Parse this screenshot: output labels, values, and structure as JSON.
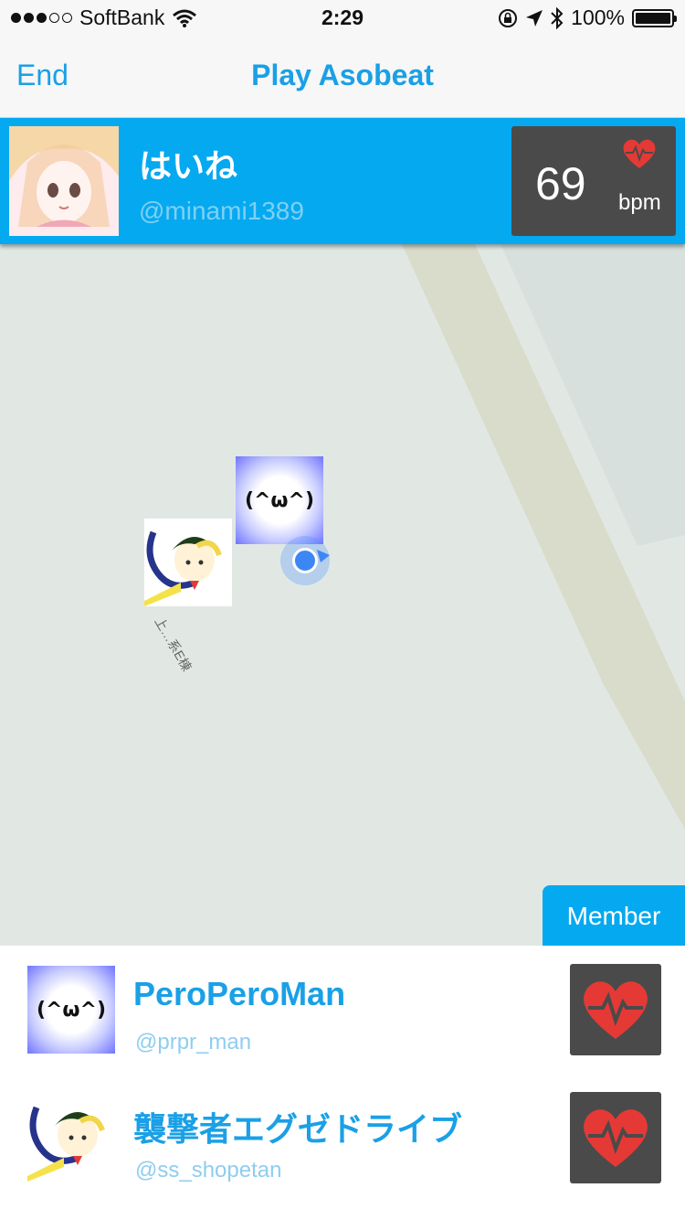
{
  "status_bar": {
    "carrier": "SoftBank",
    "time": "2:29",
    "battery": "100%"
  },
  "nav": {
    "end_label": "End",
    "title": "Play Asobeat"
  },
  "profile": {
    "name": "はいね",
    "handle": "@minami1389",
    "bpm_value": "69",
    "bpm_unit": "bpm"
  },
  "map": {
    "kaomoji": "(^ω^)",
    "label": "上…系E棟"
  },
  "member_tab": {
    "label": "Member"
  },
  "members": [
    {
      "name": "PeroPeroMan",
      "handle": "@prpr_man",
      "avatar_text": "(^ω^)"
    },
    {
      "name": "襲撃者エグゼドライブ",
      "handle": "@ss_shopetan"
    }
  ],
  "colors": {
    "accent": "#05a9f0",
    "title_blue": "#1aa0e6",
    "heart_red": "#e53935",
    "dark_box": "#4a4a4a",
    "map_bg": "#e1e8e4",
    "map_road": "#d8dccb"
  }
}
